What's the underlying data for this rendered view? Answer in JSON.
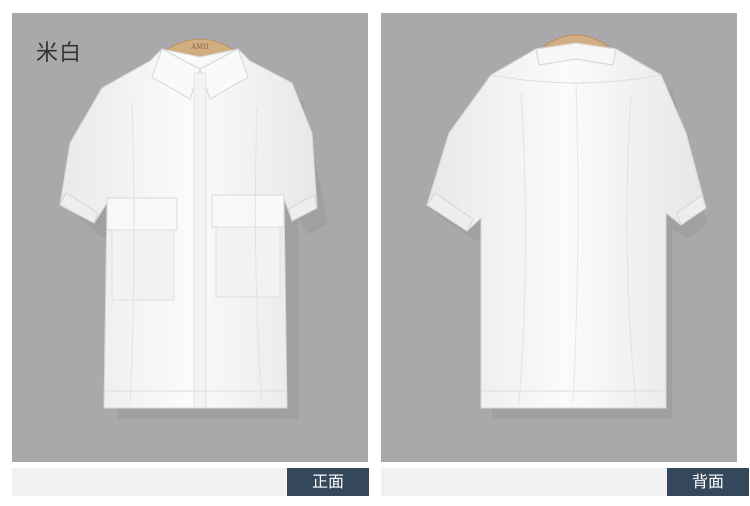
{
  "color_label": "米白",
  "hanger_brand": "AMII",
  "views": {
    "front_label": "正面",
    "back_label": "背面"
  },
  "colors": {
    "panel_background": "#a9a9ab",
    "tag_background": "#35475a",
    "strip_background": "#f1f1f1",
    "shirt": "#f6f6f4"
  }
}
